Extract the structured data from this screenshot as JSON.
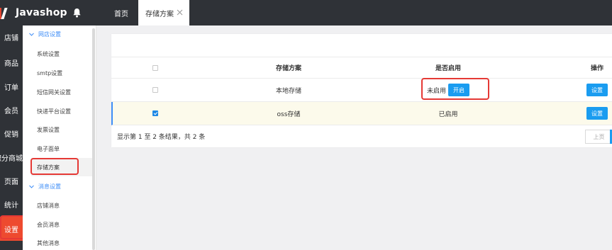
{
  "app": {
    "name": "Javashop",
    "logo_icon": "javashop-logo-icon",
    "bell_icon": "bell-icon"
  },
  "tabs": [
    {
      "label": "首页",
      "active": false
    },
    {
      "label": "存储方案",
      "active": true,
      "close_icon": "close-icon"
    }
  ],
  "leftnav": {
    "items": [
      {
        "label": "店铺",
        "active": false
      },
      {
        "label": "商品",
        "active": false
      },
      {
        "label": "订单",
        "active": false
      },
      {
        "label": "会员",
        "active": false
      },
      {
        "label": "促销",
        "active": false
      },
      {
        "label": "积分商城",
        "active": false
      },
      {
        "label": "页面",
        "active": false
      },
      {
        "label": "统计",
        "active": false
      },
      {
        "label": "设置",
        "active": true
      }
    ]
  },
  "subnav": {
    "groups": [
      {
        "title": "网店设置",
        "icon": "chevron-down-icon",
        "items": [
          "系统设置",
          "smtp设置",
          "短信网关设置",
          "快递平台设置",
          "发票设置",
          "电子面单",
          "存储方案"
        ],
        "selected": "存储方案"
      },
      {
        "title": "消息设置",
        "icon": "chevron-down-icon",
        "items": [
          "店铺消息",
          "会员消息",
          "其他消息"
        ]
      }
    ]
  },
  "table": {
    "columns": [
      "存储方案",
      "是否启用",
      "操作"
    ],
    "rows": [
      {
        "checked": false,
        "name": "本地存储",
        "status": "未启用",
        "action_label": "开启",
        "op_label": "设置"
      },
      {
        "checked": true,
        "name": "oss存储",
        "status": "已启用",
        "op_label": "设置"
      }
    ],
    "footer_text": "显示第 1 至 2 条结果，共 2 条",
    "pager_prev": "上页"
  },
  "colors": {
    "accent": "#1a9cf0",
    "nav_active": "#ee4a2f",
    "highlight": "#e53935",
    "nav_bg": "#2f3237"
  }
}
